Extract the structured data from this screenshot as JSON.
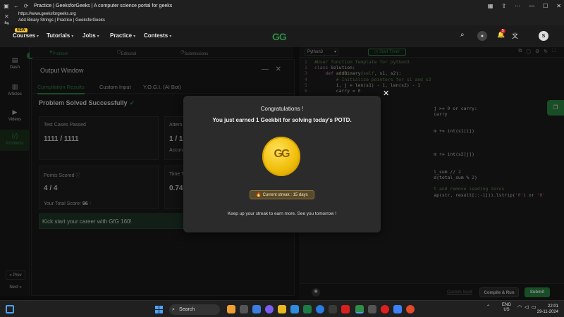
{
  "browser": {
    "title": "Practice | GeeksforGeeks | A computer science portal for geeks",
    "url": "https://www.geeksforgeeks.org",
    "subtitle": "Add Binary Strings | Practice | GeeksforGeeks"
  },
  "nav": {
    "badge": "NEW",
    "items": [
      "Courses",
      "Tutorials",
      "Jobs",
      "Practice",
      "Contests"
    ],
    "logo": "GG",
    "notif_count": "5",
    "avatar": "S"
  },
  "rail": {
    "items": [
      "Dash",
      "Articles",
      "Videos",
      "Problems"
    ],
    "prev": "« Prev",
    "next": "Next »"
  },
  "problem_tabs": [
    "Problem",
    "Editorial",
    "Submissions"
  ],
  "output": {
    "title": "Output Window",
    "tabs": [
      "Compilation Results",
      "Custom Input",
      "Y.O.G.I. (AI Bot)"
    ],
    "status": "Problem Solved Successfully",
    "test_cases_label": "Test Cases Passed",
    "test_cases_value": "1111 / 1111",
    "attempts_label": "Attem",
    "attempts_value": "1 / 1",
    "accuracy_label": "Accura",
    "points_label": "Points Scored",
    "points_value": "4 / 4",
    "total_score_label": "Your Total Score:",
    "total_score_value": "96",
    "time_label": "Time T",
    "time_value": "0.74",
    "banner": "Kick start your career with GfG 160!"
  },
  "editor": {
    "language": "Python3",
    "timer": "Start Timer",
    "lines": [
      {
        "n": "1",
        "html": "<span class='cm'>#User function Template for python3</span>"
      },
      {
        "n": "2",
        "html": "<span class='kw'>class</span> <span class='tx'>Solution:</span>"
      },
      {
        "n": "3",
        "html": "    <span class='kw'>def</span> <span class='fn'>addBinary</span><span class='tx'>(</span><span class='cm'>self</span><span class='tx'>, s1, s2):</span>"
      },
      {
        "n": "4",
        "html": "        <span class='cm'># Initialize pointers for s1 and s2</span>"
      },
      {
        "n": "5",
        "html": "        <span class='tx'>i, j = len(s1) - </span><span class='nm'>1</span><span class='tx'>, len(s2) - </span><span class='nm'>1</span>"
      },
      {
        "n": "6",
        "html": "        <span class='tx'>carry = </span><span class='nm'>0</span>"
      },
      {
        "n": "",
        "html": ""
      },
      {
        "n": "",
        "html": ""
      },
      {
        "n": "",
        "html": "                                            <span class='tx'>j &gt;= </span><span class='nm'>0</span><span class='tx'> or carry:</span>"
      },
      {
        "n": "",
        "html": "                                            <span class='tx'>carry</span>"
      },
      {
        "n": "",
        "html": ""
      },
      {
        "n": "",
        "html": ""
      },
      {
        "n": "",
        "html": "                                            <span class='tx'>m += int(s1[i])</span>"
      },
      {
        "n": "",
        "html": ""
      },
      {
        "n": "",
        "html": ""
      },
      {
        "n": "",
        "html": ""
      },
      {
        "n": "",
        "html": "                                            <span class='tx'>m += int(s2[j])</span>"
      },
      {
        "n": "",
        "html": ""
      },
      {
        "n": "",
        "html": ""
      },
      {
        "n": "",
        "html": "                                            <span class='tx'>l_sum // </span><span class='nm'>2</span>"
      },
      {
        "n": "",
        "html": "                                            <span class='tx'>d(total_sum % </span><span class='nm'>2</span><span class='tx'>)</span>"
      },
      {
        "n": "",
        "html": ""
      },
      {
        "n": "",
        "html": "                                            <span class='cm'>t and remove leading zeros</span>"
      },
      {
        "n": "",
        "html": "                                            <span class='tx'>ap(str, result[::-</span><span class='nm'>1</span><span class='tx'>])).lstrip(</span><span class='st'>'0'</span><span class='tx'>) or </span><span class='st'>'0'</span>"
      }
    ],
    "custom_input": "Custom Input",
    "compile": "Compile & Run",
    "submit": "Submit"
  },
  "modal": {
    "title": "Congratulations !",
    "message": "You just earned 1 Geekbit for solving today's POTD.",
    "coin_text": "GG",
    "streak": "Current streak : 15 days",
    "footer": "Keep up your streak to earn more. See you tomorrow !"
  },
  "taskbar": {
    "search": "Search",
    "lang1": "ENG",
    "lang2": "US",
    "time": "22:01",
    "date": "29-11-2024"
  }
}
